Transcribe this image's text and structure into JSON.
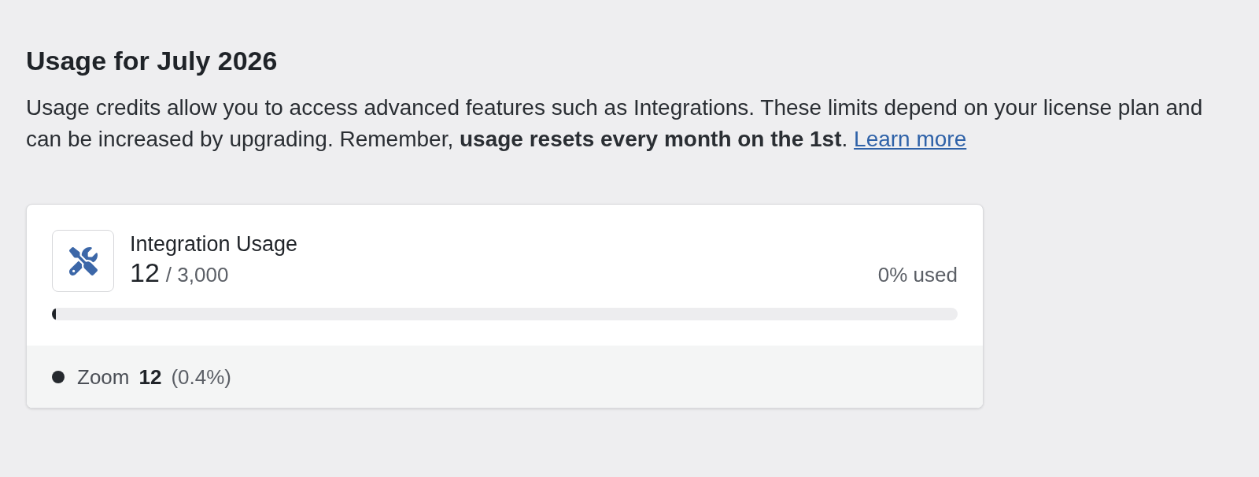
{
  "heading": "Usage for July 2026",
  "intro": {
    "text": "Usage credits allow you to access advanced features such as Integrations. These limits depend on your license plan and can be increased by upgrading. Remember, **usage resets every month on the 1st**.",
    "link": "Learn more"
  },
  "usage_card": {
    "title": "Integration Usage",
    "used": "12",
    "limit": "/ 3,000",
    "percent_used": "0% used",
    "level": 0.004,
    "breakdown": [
      {
        "name": "Zoom",
        "count": "12",
        "share": "(0.4%)",
        "color": "#25292e"
      }
    ]
  }
}
